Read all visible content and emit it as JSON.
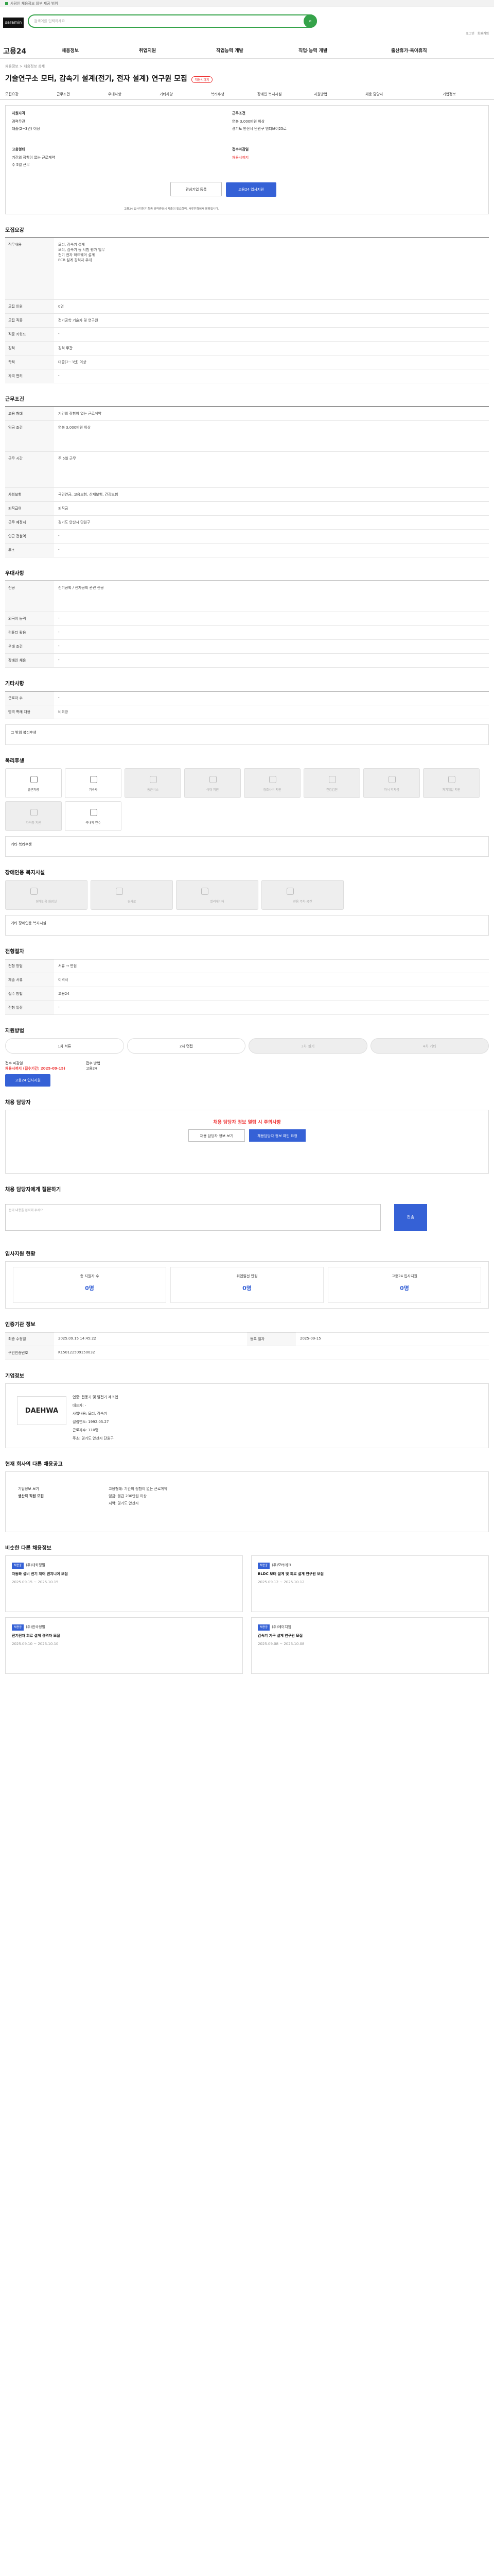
{
  "topbar": {
    "notice": "사람인 채용정보 외부 제공 범위"
  },
  "header": {
    "logo": "saramin",
    "search_placeholder": "검색어를 입력하세요",
    "util": [
      "로그인",
      "회원가입"
    ]
  },
  "gnb": {
    "brand": "고용24",
    "menus": [
      "채용정보",
      "취업지원",
      "직업능력 개발",
      "직업·능력 개발",
      "출산휴가·육아휴직"
    ]
  },
  "job": {
    "breadcrumb": "채용정보 > 채용정보 상세",
    "title": "기술연구소 모터, 감속기 설계(전기, 전자 설계) 연구원 모집",
    "badge": "채용시까지",
    "tabs": [
      "모집요강",
      "근무조건",
      "우대사항",
      "기타사항",
      "복리후생",
      "장애인 복지시설",
      "지원방법",
      "채용 담당자",
      "기업정보"
    ],
    "summary": {
      "career_label": "지원자격",
      "career": "경력무관",
      "edu_label": "학력",
      "edu": "대졸(2~3년) 이상",
      "wage_label": "근무조건",
      "wage": "연봉 3,000만원 이상",
      "location": "경기도 안산시 단원구 엠티브이25로",
      "type_label": "고용형태",
      "type": "기간의 정함이 없는 근로계약",
      "time": "주 5일 근무",
      "deadline_label": "접수마감일",
      "deadline": "채용시까지",
      "bookmark": "관심기업 등록",
      "apply": "고용24 입사지원"
    },
    "note": "고용24 입사지원은 최종 경력증명서 제출이 필요하며, 서류전형에서 활용됩니다."
  },
  "recruit": {
    "heading": "모집요강",
    "duty_label": "직무내용",
    "duties": [
      "모터, 감속기 설계",
      "모터, 감속기 등 시험 평가 업무",
      "전기 전자 하드웨어 설계",
      "PCB 설계 경력자 우대"
    ],
    "rows": [
      [
        "모집 인원",
        "0명"
      ],
      [
        "모집 직종",
        "전기공학 기술자 및 연구원"
      ],
      [
        "직종 키워드",
        "-"
      ],
      [
        "경력",
        "경력 무관"
      ],
      [
        "학력",
        "대졸(2~3년) 이상"
      ],
      [
        "자격 면허",
        "-"
      ]
    ]
  },
  "work": {
    "heading": "근무조건",
    "rows": [
      [
        "고용 형태",
        "기간의 정함이 없는 근로계약"
      ],
      [
        "임금 조건",
        "연봉 3,000만원 이상"
      ],
      [
        "근무 시간",
        "주 5일 근무"
      ],
      [
        "사회보험",
        "국민연금, 고용보험, 산재보험, 건강보험"
      ],
      [
        "퇴직급여",
        "퇴직금"
      ],
      [
        "근무 예정지",
        "경기도 안산시 단원구"
      ],
      [
        "인근 전철역",
        "-"
      ],
      [
        "주소",
        "-"
      ]
    ]
  },
  "pref": {
    "heading": "우대사항",
    "rows": [
      [
        "전공",
        "전기공학 / 전자공학 관련 전공"
      ],
      [
        "외국어 능력",
        "-"
      ],
      [
        "컴퓨터 활용",
        "-"
      ],
      [
        "우대 조건",
        "-"
      ],
      [
        "장애인 채용",
        "-"
      ]
    ]
  },
  "etc": {
    "heading": "기타사항",
    "rows": [
      [
        "근로자 수",
        "-"
      ],
      [
        "병역 특례 채용",
        "비희망"
      ]
    ],
    "etc_text": "그 밖의 복리후생"
  },
  "welfare": {
    "heading": "복리후생",
    "items": [
      "출근차량",
      "기숙사",
      "통근버스",
      "식대 지원",
      "경조사비 지원",
      "건강검진",
      "자녀 학자금",
      "자기개발 지원",
      "자격증 지원",
      "국내외 연수"
    ],
    "note": "기타 복리후생"
  },
  "disability": {
    "heading": "장애인용 복지시설",
    "items": [
      "장애인용 화장실",
      "경사로",
      "엘리베이터",
      "전용 주차 공간"
    ],
    "note": "기타 장애인용 복지시설"
  },
  "screening": {
    "heading": "전형절차",
    "rows": [
      [
        "전형 방법",
        "서류 → 면접"
      ],
      [
        "제출 서류",
        "이력서"
      ],
      [
        "접수 방법",
        "고용24"
      ],
      [
        "전형 일정",
        "-"
      ]
    ]
  },
  "apply": {
    "heading": "지원방법",
    "steps": [
      "1차 서류",
      "2차 면접",
      "3차 실기",
      "4차 기타"
    ],
    "period_label": "접수 마감일",
    "period": "채용시까지 (접수기간: 2025-09-15)",
    "method_label": "접수 방법",
    "method": "고용24",
    "btn": "고용24 입사지원"
  },
  "manager": {
    "heading": "채용 담당자",
    "alert": "채용 담당자 정보 열람 시 주의사항",
    "btn1": "채용 담당자 정보 보기",
    "btn2": "채용담당자 정보 확인 요청"
  },
  "qa": {
    "heading": "채용 담당자에게 질문하기",
    "placeholder": "문의 내용을 입력해 주세요",
    "send": "전송"
  },
  "status": {
    "heading": "입사지원 현황",
    "items": [
      [
        "총 지원자 수",
        "0명"
      ],
      [
        "취업알선 인원",
        "0명"
      ],
      [
        "고용24 입사지원",
        "0명"
      ]
    ]
  },
  "posting": {
    "heading": "인증기관 정보",
    "rows": [
      [
        "최종 수정일",
        "2025.09.15 14:45:22"
      ],
      [
        "등록 일자",
        "2025-09-15"
      ],
      [
        "구인인증번호",
        "K150122509150032"
      ]
    ]
  },
  "company": {
    "heading": "기업정보",
    "logo": "DAEHWA",
    "rows": [
      "업종: 전동기 및 발전기 제조업",
      "대표자: -",
      "사업내용: 모터, 감속기",
      "설립연도: 1992.05.27",
      "근로자수: 110명",
      "주소: 경기도 안산시 단원구"
    ]
  },
  "same": {
    "heading": "현재 회사의 다른 채용공고",
    "left": "기업정보 보기",
    "title": "생산직 직원 모집",
    "right": [
      "고용형태: 기간의 정함이 없는 근로계약",
      "임금: 월급 230만원 이상",
      "지역: 경기도 안산시"
    ]
  },
  "similar": {
    "heading": "비슷한 다른 채용정보",
    "cards": [
      {
        "tag": "채용중",
        "co": "(주)대화정밀",
        "title": "자동화 설비 전기 제어 엔지니어 모집",
        "date": "2025.09.15 ~ 2025.10.15"
      },
      {
        "tag": "채용중",
        "co": "(주)모터테크",
        "title": "BLDC 모터 설계 및 회로 설계 연구원 모집",
        "date": "2025.09.12 ~ 2025.10.12"
      },
      {
        "tag": "채용중",
        "co": "(주)한국정밀",
        "title": "전기전자 회로 설계 경력자 모집",
        "date": "2025.09.10 ~ 2025.10.10"
      },
      {
        "tag": "채용중",
        "co": "(주)에이치엠",
        "title": "감속기 기구 설계 연구원 모집",
        "date": "2025.09.08 ~ 2025.10.08"
      }
    ]
  }
}
